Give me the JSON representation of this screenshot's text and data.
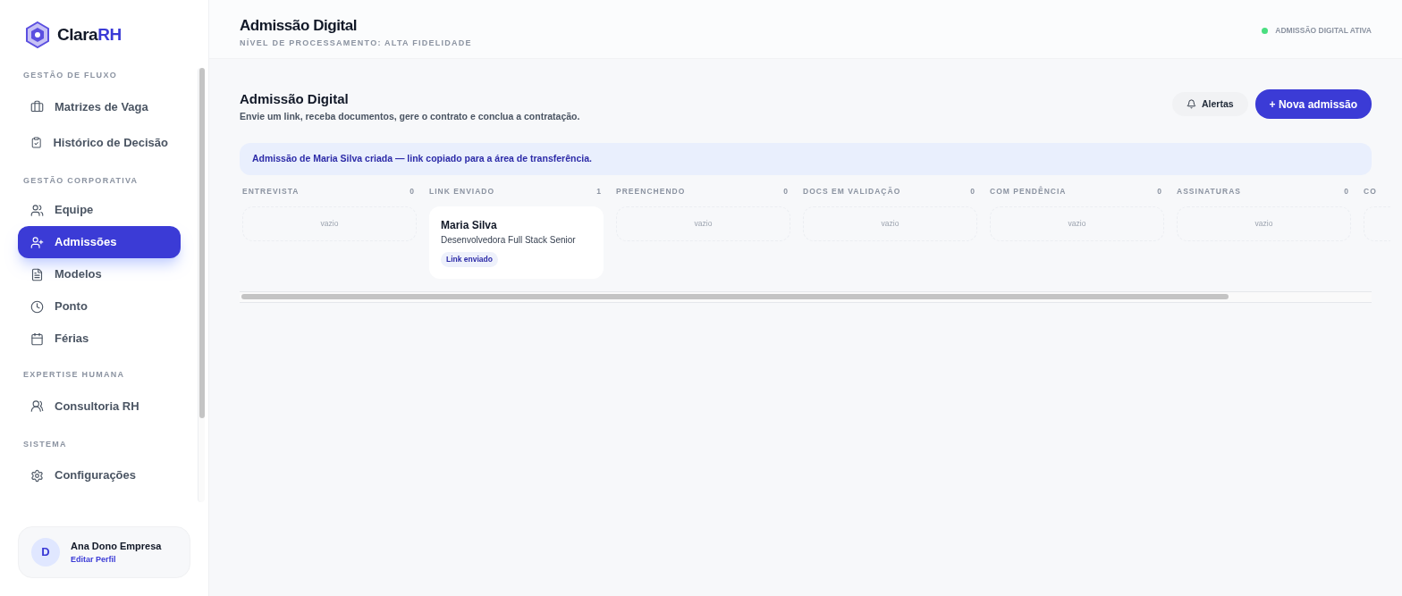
{
  "brand": {
    "name": "Clara",
    "accent": "RH"
  },
  "sidebar": {
    "sections": [
      {
        "title": "GESTÃO DE FLUXO",
        "items": [
          {
            "label": "Matrizes de Vaga",
            "selected": false
          },
          {
            "label": "Histórico de Decisão",
            "selected": false
          }
        ]
      },
      {
        "title": "GESTÃO CORPORATIVA",
        "items": [
          {
            "label": "Equipe",
            "selected": false
          },
          {
            "label": "Admissões",
            "selected": true
          },
          {
            "label": "Modelos",
            "selected": false
          },
          {
            "label": "Ponto",
            "selected": false
          },
          {
            "label": "Férias",
            "selected": false
          }
        ]
      },
      {
        "title": "EXPERTISE HUMANA",
        "items": [
          {
            "label": "Consultoria RH",
            "selected": false
          }
        ]
      },
      {
        "title": "SISTEMA",
        "items": [
          {
            "label": "Configurações",
            "selected": false
          }
        ]
      }
    ]
  },
  "user": {
    "initial": "D",
    "name": "Ana Dono Empresa",
    "link": "Editar Perfil"
  },
  "header": {
    "title": "Admissão Digital",
    "subtitle": "NÍVEL DE PROCESSAMENTO: ALTA FIDELIDADE",
    "status": {
      "label": "ADMISSÃO DIGITAL ATIVA",
      "color": "#4ade80"
    }
  },
  "page": {
    "title": "Admissão Digital",
    "description": "Envie um link, receba documentos, gere o contrato e conclua a contratação.",
    "alerts_button": "Alertas",
    "new_button": "+ Nova admissão"
  },
  "notice": "Admissão de Maria Silva criada — link copiado para a área de transferência.",
  "board": {
    "columns": [
      {
        "title": "ENTREVISTA",
        "count": "0",
        "empty": "vazio"
      },
      {
        "title": "LINK ENVIADO",
        "count": "1",
        "cards": [
          {
            "name": "Maria Silva",
            "role": "Desenvolvedora Full Stack Senior",
            "tag": "Link enviado"
          }
        ]
      },
      {
        "title": "PREENCHENDO",
        "count": "0",
        "empty": "vazio"
      },
      {
        "title": "DOCS EM VALIDAÇÃO",
        "count": "0",
        "empty": "vazio"
      },
      {
        "title": "COM PENDÊNCIA",
        "count": "0",
        "empty": "vazio"
      },
      {
        "title": "ASSINATURAS",
        "count": "0",
        "empty": "vazio"
      },
      {
        "title": "CO"
      }
    ]
  }
}
